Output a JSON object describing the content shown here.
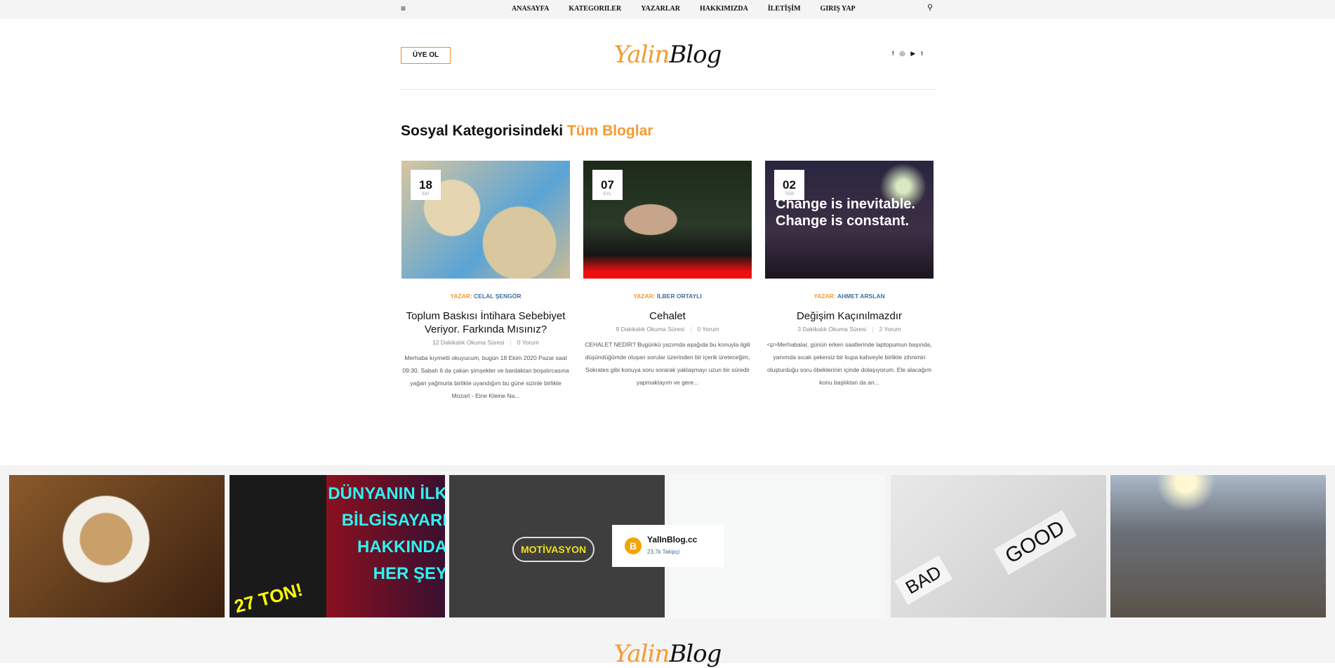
{
  "topbar": {
    "menu_icon": "≡",
    "nav": [
      "ANASAYFA",
      "KATEGORILER",
      "YAZARLAR",
      "HAKKIMIZDA",
      "İLETİŞİM",
      "GIRIŞ YAP"
    ],
    "search_icon": "⚲"
  },
  "header": {
    "signup": "ÜYE OL",
    "logo_a": "Yalin",
    "logo_b": "Blog",
    "social": [
      "f",
      "◎",
      "▶",
      "t"
    ]
  },
  "heading": {
    "text": "Sosyal Kategorisindeki ",
    "highlight": "Tüm Bloglar"
  },
  "posts": [
    {
      "day": "18",
      "month": "EKİ",
      "author_label": "YAZAR: ",
      "author": "CELAL ŞENGÖR",
      "title": "Toplum Baskısı İntihara Sebebiyet Veriyor. Farkında Mısınız?",
      "reading": "12 Dakikalık Okuma Süresi",
      "comments": "0 Yorum",
      "excerpt": "Merhaba kıymetli okuyucum, bugün 18 Ekim 2020 Pazar saat 09:30. Sabah 6 da çakan şimşekler ve bardaktan boşalırcasına yağan yağmurla birlikte uyandığım bu güne sizinle birlikte Mozart - Eine Kleine Na..."
    },
    {
      "day": "07",
      "month": "EYL",
      "author_label": "YAZAR: ",
      "author": "İLBER ORTAYLI",
      "title": "Cehalet",
      "reading": "9 Dakikalık Okuma Süresi",
      "comments": "0 Yorum",
      "excerpt": "CEHALET NEDİR? Bugünkü yazımda aşağıda bu konuyla ilgili düşündüğümde oluşan sorular üzerinden bir içerik üreteceğim, Sokrates gibi konuya soru sorarak yaklaşmayı uzun bir süredir yapmaktayım ve gere..."
    },
    {
      "day": "02",
      "month": "TEM",
      "author_label": "YAZAR: ",
      "author": "AHMET ARSLAN",
      "title": "Değişim Kaçınılmazdır",
      "reading": "3 Dakikalık Okuma Süresi",
      "comments": "2 Yorum",
      "excerpt": "<p>Merhabalar, günün erken saatlerinde laptopumun başında, yanımda sıcak şekersiz bir kupa kahveyle birlikte zihnimin oluşturduğu soru öbeklerinin içinde dolaşıyorum. Ele alacağım konu başlıktan da an...",
      "image_text": "Change is inevitable. Change is constant."
    }
  ],
  "instagram": {
    "tiles": [
      "coffee",
      "eniac",
      "motivasyon",
      "cup",
      "bad-good",
      "earthquake"
    ],
    "eniac_text": "DÜNYANIN İLK BİLGİSAYARI HAKKINDA HER ŞEY",
    "eniac_badge": "27 TON!",
    "motiv_text": "MOTİVASYON",
    "good": "GOOD",
    "bad": "BAD",
    "widget_name": "YalInBlog.cc",
    "widget_followers": "23,7k Takipçi"
  },
  "footer": {
    "logo_a": "Yalin",
    "logo_b": "Blog"
  }
}
